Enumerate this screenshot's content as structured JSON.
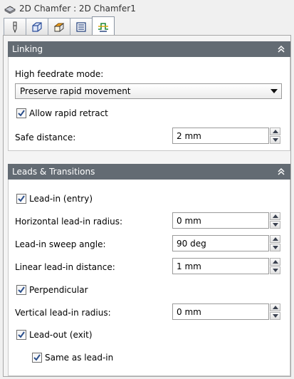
{
  "window": {
    "title": "2D Chamfer : 2D Chamfer1",
    "icon": "chamfer-icon"
  },
  "tabs": [
    {
      "name": "tool",
      "icon": "tool-icon",
      "active": false
    },
    {
      "name": "geometry",
      "icon": "geometry-icon",
      "active": false
    },
    {
      "name": "heights",
      "icon": "heights-icon",
      "active": false
    },
    {
      "name": "passes",
      "icon": "passes-icon",
      "active": false
    },
    {
      "name": "linking",
      "icon": "linking-icon",
      "active": true
    }
  ],
  "linking": {
    "header": "Linking",
    "high_feedrate_mode_label": "High feedrate mode:",
    "high_feedrate_mode_value": "Preserve rapid movement",
    "allow_rapid_retract_label": "Allow rapid retract",
    "allow_rapid_retract_checked": true,
    "safe_distance_label": "Safe distance:",
    "safe_distance_value": "2 mm"
  },
  "leads": {
    "header": "Leads & Transitions",
    "lead_in_label": "Lead-in (entry)",
    "lead_in_checked": true,
    "horizontal_lead_in_radius_label": "Horizontal lead-in radius:",
    "horizontal_lead_in_radius_value": "0 mm",
    "lead_in_sweep_angle_label": "Lead-in sweep angle:",
    "lead_in_sweep_angle_value": "90 deg",
    "linear_lead_in_distance_label": "Linear lead-in distance:",
    "linear_lead_in_distance_value": "1 mm",
    "perpendicular_label": "Perpendicular",
    "perpendicular_checked": true,
    "vertical_lead_in_radius_label": "Vertical lead-in radius:",
    "vertical_lead_in_radius_value": "0 mm",
    "lead_out_label": "Lead-out (exit)",
    "lead_out_checked": true,
    "same_as_lead_in_label": "Same as lead-in",
    "same_as_lead_in_checked": true
  },
  "colors": {
    "section_header_bg": "#636b73",
    "checkmark": "#2b4f8c"
  }
}
